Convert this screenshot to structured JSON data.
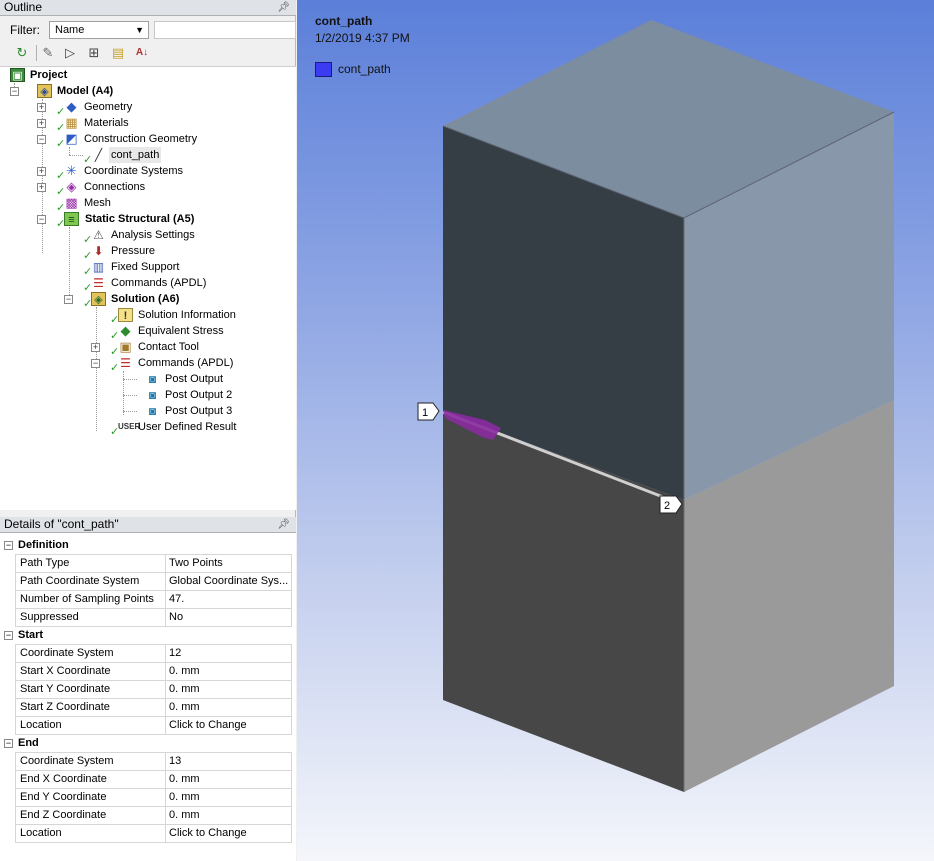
{
  "outline": {
    "title": "Outline",
    "pin_icon": "pin-icon",
    "filter_label": "Filter:",
    "filter_value": "Name",
    "toolbar": [
      "refresh-icon",
      "edit-icon",
      "filter-icon",
      "expand-all-icon",
      "folder-icon",
      "sort-icon"
    ],
    "tree": [
      {
        "label": "Project",
        "icon": "project-icon",
        "bold": true
      },
      {
        "label": "Model (A4)",
        "icon": "model-icon",
        "bold": true
      },
      {
        "label": "Geometry",
        "icon": "geometry-icon"
      },
      {
        "label": "Materials",
        "icon": "materials-icon"
      },
      {
        "label": "Construction Geometry",
        "icon": "construction-geometry-icon"
      },
      {
        "label": "cont_path",
        "icon": "path-icon",
        "selected": true
      },
      {
        "label": "Coordinate Systems",
        "icon": "coordinate-systems-icon"
      },
      {
        "label": "Connections",
        "icon": "connections-icon"
      },
      {
        "label": "Mesh",
        "icon": "mesh-icon"
      },
      {
        "label": "Static Structural (A5)",
        "icon": "static-structural-icon",
        "bold": true
      },
      {
        "label": "Analysis Settings",
        "icon": "analysis-settings-icon"
      },
      {
        "label": "Pressure",
        "icon": "pressure-icon"
      },
      {
        "label": "Fixed Support",
        "icon": "fixed-support-icon"
      },
      {
        "label": "Commands (APDL)",
        "icon": "commands-icon"
      },
      {
        "label": "Solution (A6)",
        "icon": "solution-icon",
        "bold": true
      },
      {
        "label": "Solution Information",
        "icon": "solution-information-icon"
      },
      {
        "label": "Equivalent Stress",
        "icon": "equivalent-stress-icon"
      },
      {
        "label": "Contact Tool",
        "icon": "contact-tool-icon"
      },
      {
        "label": "Commands (APDL)",
        "icon": "commands-icon"
      },
      {
        "label": "Post Output",
        "icon": "camera-icon"
      },
      {
        "label": "Post Output 2",
        "icon": "camera-icon"
      },
      {
        "label": "Post Output 3",
        "icon": "camera-icon"
      },
      {
        "label": "User Defined Result",
        "icon": "user-defined-result-icon"
      }
    ]
  },
  "details": {
    "title": "Details of \"cont_path\"",
    "groups": [
      {
        "name": "Definition",
        "rows": [
          {
            "name": "Path Type",
            "value": "Two Points"
          },
          {
            "name": "Path Coordinate System",
            "value": "Global Coordinate Sys..."
          },
          {
            "name": "Number of Sampling Points",
            "value": "47."
          },
          {
            "name": "Suppressed",
            "value": "No"
          }
        ]
      },
      {
        "name": "Start",
        "rows": [
          {
            "name": "Coordinate System",
            "value": "12"
          },
          {
            "name": "Start X Coordinate",
            "value": "0. mm"
          },
          {
            "name": "Start Y Coordinate",
            "value": "0. mm"
          },
          {
            "name": "Start Z Coordinate",
            "value": "0. mm"
          },
          {
            "name": "Location",
            "value": "Click to Change"
          }
        ]
      },
      {
        "name": "End",
        "rows": [
          {
            "name": "Coordinate System",
            "value": "13"
          },
          {
            "name": "End X Coordinate",
            "value": "0. mm"
          },
          {
            "name": "End Y Coordinate",
            "value": "0. mm"
          },
          {
            "name": "End Z Coordinate",
            "value": "0. mm"
          },
          {
            "name": "Location",
            "value": "Click to Change"
          }
        ]
      }
    ]
  },
  "viewport": {
    "title": "cont_path",
    "date": "1/2/2019 4:37 PM",
    "legend_label": "cont_path",
    "legend_color": "#3b3bf2",
    "marker_start": "1",
    "marker_end": "2"
  }
}
